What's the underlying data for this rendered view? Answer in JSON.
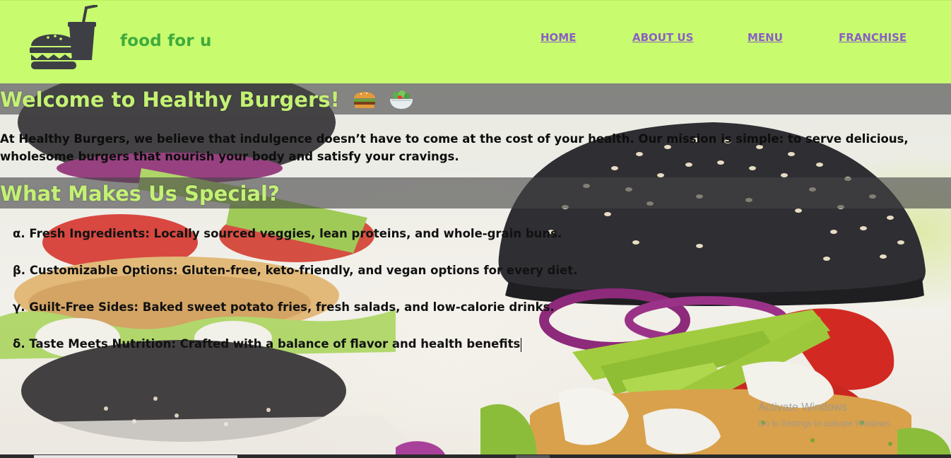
{
  "header": {
    "brand": "food for u",
    "logo_icon": "burger-and-drink-icon",
    "nav": [
      "HOME",
      "ABOUT US",
      "MENU",
      "FRANCHISE"
    ],
    "background_color": "#c8fc6e",
    "brand_color": "#3fab3c",
    "nav_color": "#8a5ec4"
  },
  "main": {
    "title": "Welcome to Healthy Burgers!",
    "title_emojis": [
      "burger-emoji-icon",
      "salad-emoji-icon"
    ],
    "intro": "At Healthy Burgers, we believe that indulgence doesn’t have to come at the cost of your health. Our mission is simple: to serve delicious, wholesome burgers that nourish your body and satisfy your cravings.",
    "section_title": "What Makes Us Special?",
    "features": [
      "α. Fresh Ingredients: Locally sourced veggies, lean proteins, and whole-grain buns.",
      "β. Customizable Options: Gluten-free, keto-friendly, and vegan options for every diet.",
      "γ. Guilt-Free Sides: Baked sweet potato fries, fresh salads, and low-calorie drinks.",
      "δ. Taste Meets Nutrition: Crafted with a balance of flavor and health benefits"
    ],
    "heading_color": "#c3f174"
  },
  "watermark": {
    "title": "Activate Windows",
    "subtitle": "Go to Settings to activate Windows."
  }
}
